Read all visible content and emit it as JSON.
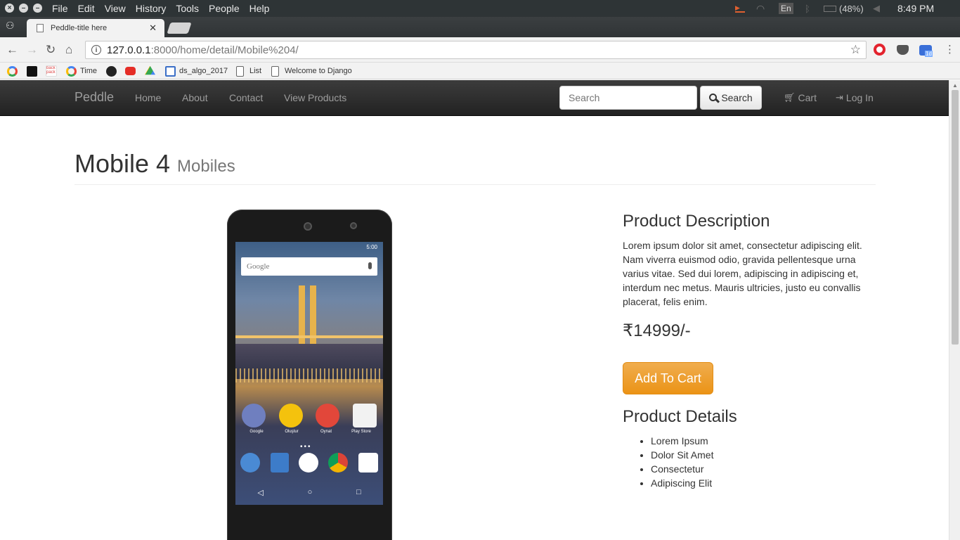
{
  "os": {
    "menu": [
      "File",
      "Edit",
      "View",
      "History",
      "Tools",
      "People",
      "Help"
    ],
    "keyboard_layout": "En",
    "battery": "(48%)",
    "clock": "8:49 PM"
  },
  "browser": {
    "tab_title": "Peddle-title here",
    "url_host": "127.0.0.1",
    "url_path": ":8000/home/detail/Mobile%204/",
    "extension_badge": "1d",
    "bookmarks": {
      "time": "Time",
      "backpack": "back pack",
      "ds_algo": "ds_algo_2017",
      "list": "List",
      "django": "Welcome to Django"
    }
  },
  "navbar": {
    "brand": "Peddle",
    "links": [
      "Home",
      "About",
      "Contact",
      "View Products"
    ],
    "search_placeholder": "Search",
    "search_button": "Search",
    "cart": "Cart",
    "login": "Log In"
  },
  "product": {
    "name": "Mobile 4",
    "category": "Mobiles",
    "description_heading": "Product Description",
    "description": "Lorem ipsum dolor sit amet, consectetur adipiscing elit. Nam viverra euismod odio, gravida pellentesque urna varius vitae. Sed dui lorem, adipiscing in adipiscing et, interdum nec metus. Mauris ultricies, justo eu convallis placerat, felis enim.",
    "price": "₹14999/-",
    "add_to_cart": "Add To Cart",
    "details_heading": "Product Details",
    "details": [
      "Lorem Ipsum",
      "Dolor Sit Amet",
      "Consectetur",
      "Adipiscing Elit"
    ]
  },
  "phone_screen": {
    "time": "5:00",
    "search_brand": "Google",
    "apps": [
      "Google",
      "Oluştur",
      "Oynat",
      "Play Store"
    ]
  },
  "colors": {
    "navbar_bg": "#222222",
    "cart_button": "#f0ad4e",
    "os_bar": "#2e3436"
  }
}
